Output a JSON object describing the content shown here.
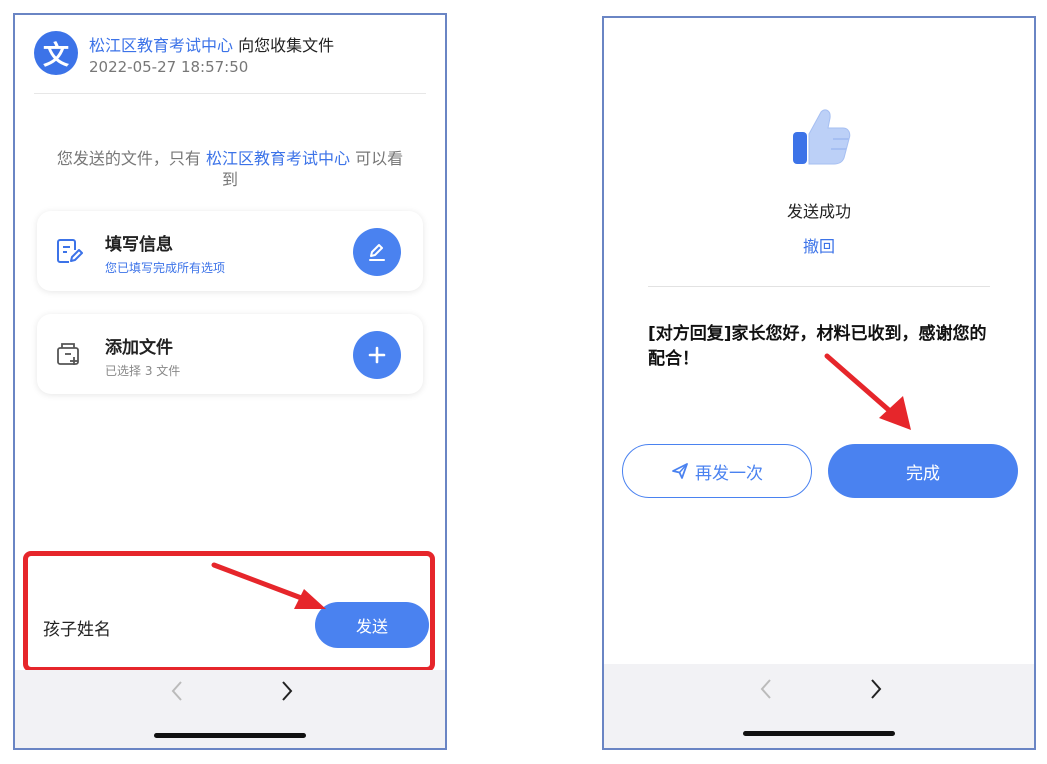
{
  "left_screen": {
    "header": {
      "org_name": "松江区教育考试中心",
      "title_suffix": " 向您收集文件",
      "timestamp": "2022-05-27 18:57:50",
      "logo_glyph": "文",
      "logo_icon": "translate-logo-icon"
    },
    "notice": {
      "prefix": "您发送的文件，只有 ",
      "org_name": "松江区教育考试中心",
      "suffix": " 可以看到"
    },
    "fill_info_card": {
      "title": "填写信息",
      "subtitle": "您已填写完成所有选项",
      "icon": "form-edit-icon",
      "button_icon": "pencil-icon"
    },
    "add_file_card": {
      "title": "添加文件",
      "subtitle": "已选择 3 文件",
      "icon": "file-add-icon",
      "button_icon": "plus-icon"
    },
    "bottom_bar": {
      "name_label": "孩子姓名",
      "send_label": "发送"
    }
  },
  "right_screen": {
    "status": {
      "success_label": "发送成功",
      "undo_label": "撤回",
      "icon": "thumbs-up-icon"
    },
    "reply_message": "[对方回复]家长您好，材料已收到，感谢您的配合！",
    "buttons": {
      "resend_label": "再发一次",
      "resend_icon": "paper-plane-icon",
      "done_label": "完成"
    }
  },
  "navigation": {
    "prev_icon": "chevron-left-icon",
    "next_icon": "chevron-right-icon"
  },
  "colors": {
    "accent": "#4a82f0",
    "link": "#3c73e8",
    "highlight": "#e6262b",
    "frame": "#6a85c4"
  }
}
